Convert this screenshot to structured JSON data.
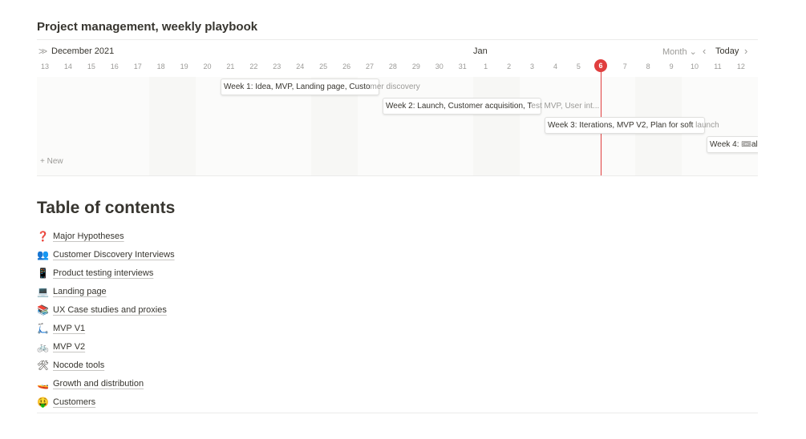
{
  "database": {
    "title": "Project management, weekly playbook"
  },
  "timeline": {
    "month_left": "December 2021",
    "month_right": "Jan",
    "view_label": "Month ⌄",
    "today_label": "Today",
    "today_day": "6",
    "days": [
      "13",
      "14",
      "15",
      "16",
      "17",
      "18",
      "19",
      "20",
      "21",
      "22",
      "23",
      "24",
      "25",
      "26",
      "27",
      "28",
      "29",
      "30",
      "31",
      "1",
      "2",
      "3",
      "4",
      "5",
      "",
      "7",
      "8",
      "9",
      "10",
      "11",
      "12"
    ],
    "cards": [
      {
        "title": "Week 1: Idea, MVP, Landing page, Custo",
        "overflow": "mer discovery"
      },
      {
        "title": "Week 2: Launch, Customer acquisition, T",
        "overflow": "est MVP, User int..."
      },
      {
        "title": "Week 3: Iterations, MVP V2, Plan for soft",
        "overflow": " launch"
      },
      {
        "title": "Week 4: 🎟al",
        "overflow": ""
      }
    ],
    "new_label": "+ New"
  },
  "toc": {
    "heading": "Table of contents",
    "items": [
      {
        "emoji": "❓",
        "label": "Major Hypotheses"
      },
      {
        "emoji": "👥",
        "label": "Customer Discovery Interviews"
      },
      {
        "emoji": "📱",
        "label": "Product testing interviews"
      },
      {
        "emoji": "💻",
        "label": "Landing page"
      },
      {
        "emoji": "📚",
        "label": "UX Case studies and proxies"
      },
      {
        "emoji": "🛴",
        "label": "MVP V1"
      },
      {
        "emoji": "🚲",
        "label": "MVP V2"
      },
      {
        "emoji": "🛠",
        "label": "Nocode tools"
      },
      {
        "emoji": "🚤",
        "label": "Growth and distribution"
      },
      {
        "emoji": "🤑",
        "label": "Customers"
      }
    ]
  }
}
